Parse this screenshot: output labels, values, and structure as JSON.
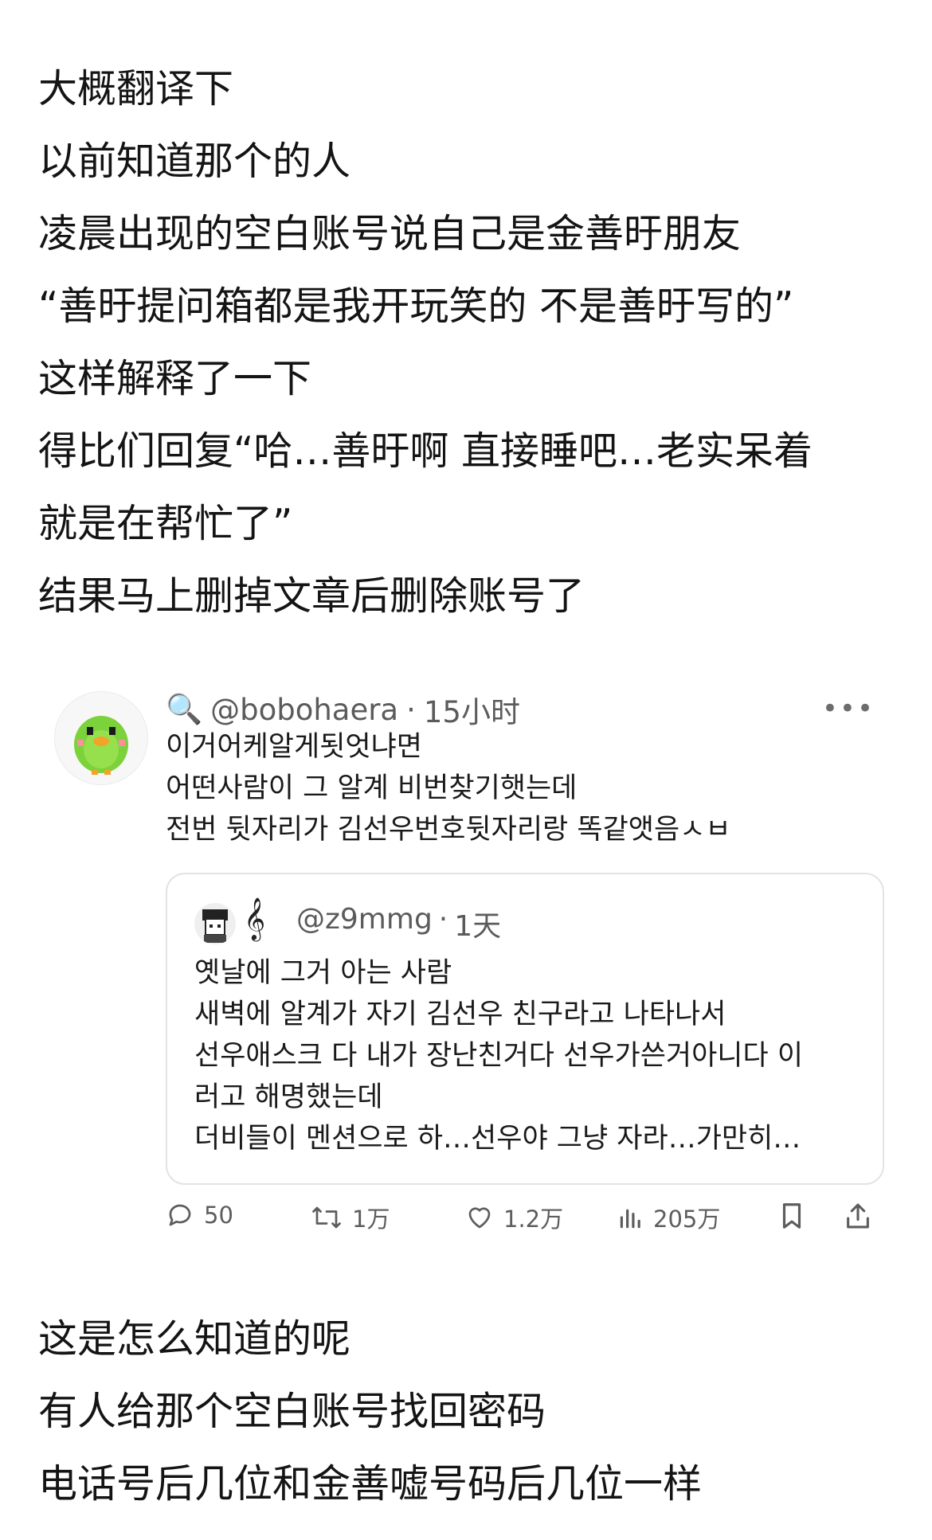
{
  "post": {
    "top_lines": [
      "大概翻译下",
      "以前知道那个的人",
      "凌晨出现的空白账号说自己是金善旴朋友",
      "“善旴提问箱都是我开玩笑的 不是善旴写的”",
      "这样解释了一下",
      "得比们回复“哈…善旴啊 直接睡吧…老实呆着",
      "就是在帮忙了”",
      "结果马上删掉文章后删除账号了"
    ],
    "bottom_lines": [
      "这是怎么知道的呢",
      "有人给那个空白账号找回密码",
      "电话号后几位和金善嘘号码后几位一样"
    ]
  },
  "tweet": {
    "search_emoji": "🔍",
    "handle": "@bobohaera",
    "dot": "·",
    "time": "15小时",
    "more": "•••",
    "lines": [
      "이거어케알게됫엇냐면",
      "어떤사람이 그 알계 비번찾기햇는데",
      "전번 뒷자리가 김선우번호뒷자리랑 똑같앳음ㅅㅂ"
    ],
    "quote": {
      "handle": "@z9mmg",
      "dot": "·",
      "time": "1天",
      "lines": [
        "옛날에 그거 아는 사람",
        "새벽에 알계가 자기 김선우 친구라고 나타나서",
        "선우애스크 다 내가 장난친거다 선우가쓴거아니다 이",
        "러고 해명했는데",
        "더비들이 멘션으로 하…선우야 그냥 자라…가만히…"
      ]
    },
    "actions": {
      "replies": "50",
      "retweets": "1万",
      "likes": "1.2万",
      "views": "205万"
    }
  }
}
